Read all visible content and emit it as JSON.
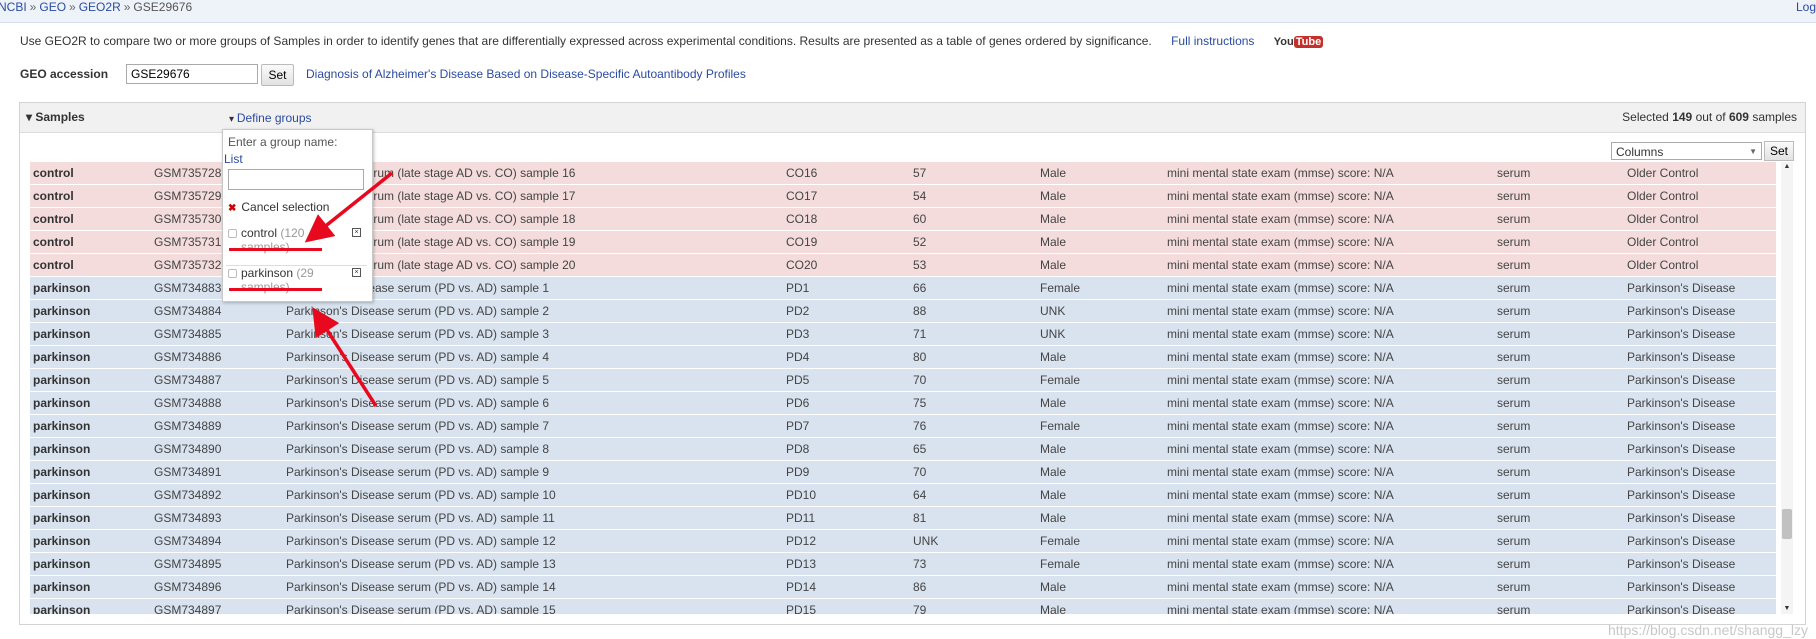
{
  "breadcrumb": {
    "items": [
      "NCBI",
      "GEO",
      "GEO2R",
      "GSE29676"
    ],
    "separator": "»",
    "login": "Log"
  },
  "intro": {
    "text": "Use GEO2R to compare two or more groups of Samples in order to identify genes that are differentially expressed across experimental conditions. Results are presented as a table of genes ordered by significance.",
    "link": "Full instructions",
    "youtube_you": "You",
    "youtube_tube": "Tube"
  },
  "accession": {
    "label": "GEO accession",
    "value": "GSE29676",
    "set_label": "Set",
    "study_title": "Diagnosis of Alzheimer's Disease Based on Disease-Specific Autoantibody Profiles"
  },
  "samples_panel": {
    "title": "Samples",
    "define_groups": "Define groups",
    "selected_prefix": "Selected",
    "selected_count": "149",
    "selected_mid": "out of",
    "total_count": "609",
    "selected_suffix": "samples",
    "columns_select": "Columns",
    "columns_set": "Set"
  },
  "group_popup": {
    "prompt": "Enter a group name:",
    "list_link": "List",
    "cancel": "Cancel selection",
    "groups": [
      {
        "name": "control",
        "count": "(120 samples)"
      },
      {
        "name": "parkinson",
        "count": "(29 samples)"
      }
    ]
  },
  "colors": {
    "control_row": "#f4dcdc",
    "parkinson_row": "#d8e3ef",
    "annotation_red": "#e8091e",
    "link_blue": "#2a4ba1"
  },
  "rows": [
    {
      "group": "control",
      "acc": "GSM735728",
      "title": "Older Control serum (late stage AD vs. CO) sample 16",
      "id": "CO16",
      "age": "57",
      "sex": "Male",
      "mmse": "mini mental state exam (mmse) score: N/A",
      "source": "serum",
      "disease": "Older Control"
    },
    {
      "group": "control",
      "acc": "GSM735729",
      "title": "Older Control serum (late stage AD vs. CO) sample 17",
      "id": "CO17",
      "age": "54",
      "sex": "Male",
      "mmse": "mini mental state exam (mmse) score: N/A",
      "source": "serum",
      "disease": "Older Control"
    },
    {
      "group": "control",
      "acc": "GSM735730",
      "title": "Older Control serum (late stage AD vs. CO) sample 18",
      "id": "CO18",
      "age": "60",
      "sex": "Male",
      "mmse": "mini mental state exam (mmse) score: N/A",
      "source": "serum",
      "disease": "Older Control"
    },
    {
      "group": "control",
      "acc": "GSM735731",
      "title": "Older Control serum (late stage AD vs. CO) sample 19",
      "id": "CO19",
      "age": "52",
      "sex": "Male",
      "mmse": "mini mental state exam (mmse) score: N/A",
      "source": "serum",
      "disease": "Older Control"
    },
    {
      "group": "control",
      "acc": "GSM735732",
      "title": "Older Control serum (late stage AD vs. CO) sample 20",
      "id": "CO20",
      "age": "53",
      "sex": "Male",
      "mmse": "mini mental state exam (mmse) score: N/A",
      "source": "serum",
      "disease": "Older Control"
    },
    {
      "group": "parkinson",
      "acc": "GSM734883",
      "title": "Parkinson's Disease serum (PD vs. AD) sample 1",
      "id": "PD1",
      "age": "66",
      "sex": "Female",
      "mmse": "mini mental state exam (mmse) score: N/A",
      "source": "serum",
      "disease": "Parkinson's Disease"
    },
    {
      "group": "parkinson",
      "acc": "GSM734884",
      "title": "Parkinson's Disease serum (PD vs. AD) sample 2",
      "id": "PD2",
      "age": "88",
      "sex": "UNK",
      "mmse": "mini mental state exam (mmse) score: N/A",
      "source": "serum",
      "disease": "Parkinson's Disease"
    },
    {
      "group": "parkinson",
      "acc": "GSM734885",
      "title": "Parkinson's Disease serum (PD vs. AD) sample 3",
      "id": "PD3",
      "age": "71",
      "sex": "UNK",
      "mmse": "mini mental state exam (mmse) score: N/A",
      "source": "serum",
      "disease": "Parkinson's Disease"
    },
    {
      "group": "parkinson",
      "acc": "GSM734886",
      "title": "Parkinson's Disease serum (PD vs. AD) sample 4",
      "id": "PD4",
      "age": "80",
      "sex": "Male",
      "mmse": "mini mental state exam (mmse) score: N/A",
      "source": "serum",
      "disease": "Parkinson's Disease"
    },
    {
      "group": "parkinson",
      "acc": "GSM734887",
      "title": "Parkinson's Disease serum (PD vs. AD) sample 5",
      "id": "PD5",
      "age": "70",
      "sex": "Female",
      "mmse": "mini mental state exam (mmse) score: N/A",
      "source": "serum",
      "disease": "Parkinson's Disease"
    },
    {
      "group": "parkinson",
      "acc": "GSM734888",
      "title": "Parkinson's Disease serum (PD vs. AD) sample 6",
      "id": "PD6",
      "age": "75",
      "sex": "Male",
      "mmse": "mini mental state exam (mmse) score: N/A",
      "source": "serum",
      "disease": "Parkinson's Disease"
    },
    {
      "group": "parkinson",
      "acc": "GSM734889",
      "title": "Parkinson's Disease serum (PD vs. AD) sample 7",
      "id": "PD7",
      "age": "76",
      "sex": "Female",
      "mmse": "mini mental state exam (mmse) score: N/A",
      "source": "serum",
      "disease": "Parkinson's Disease"
    },
    {
      "group": "parkinson",
      "acc": "GSM734890",
      "title": "Parkinson's Disease serum (PD vs. AD) sample 8",
      "id": "PD8",
      "age": "65",
      "sex": "Male",
      "mmse": "mini mental state exam (mmse) score: N/A",
      "source": "serum",
      "disease": "Parkinson's Disease"
    },
    {
      "group": "parkinson",
      "acc": "GSM734891",
      "title": "Parkinson's Disease serum (PD vs. AD) sample 9",
      "id": "PD9",
      "age": "70",
      "sex": "Male",
      "mmse": "mini mental state exam (mmse) score: N/A",
      "source": "serum",
      "disease": "Parkinson's Disease"
    },
    {
      "group": "parkinson",
      "acc": "GSM734892",
      "title": "Parkinson's Disease serum (PD vs. AD) sample 10",
      "id": "PD10",
      "age": "64",
      "sex": "Male",
      "mmse": "mini mental state exam (mmse) score: N/A",
      "source": "serum",
      "disease": "Parkinson's Disease"
    },
    {
      "group": "parkinson",
      "acc": "GSM734893",
      "title": "Parkinson's Disease serum (PD vs. AD) sample 11",
      "id": "PD11",
      "age": "81",
      "sex": "Male",
      "mmse": "mini mental state exam (mmse) score: N/A",
      "source": "serum",
      "disease": "Parkinson's Disease"
    },
    {
      "group": "parkinson",
      "acc": "GSM734894",
      "title": "Parkinson's Disease serum (PD vs. AD) sample 12",
      "id": "PD12",
      "age": "UNK",
      "sex": "Female",
      "mmse": "mini mental state exam (mmse) score: N/A",
      "source": "serum",
      "disease": "Parkinson's Disease"
    },
    {
      "group": "parkinson",
      "acc": "GSM734895",
      "title": "Parkinson's Disease serum (PD vs. AD) sample 13",
      "id": "PD13",
      "age": "73",
      "sex": "Female",
      "mmse": "mini mental state exam (mmse) score: N/A",
      "source": "serum",
      "disease": "Parkinson's Disease"
    },
    {
      "group": "parkinson",
      "acc": "GSM734896",
      "title": "Parkinson's Disease serum (PD vs. AD) sample 14",
      "id": "PD14",
      "age": "86",
      "sex": "Male",
      "mmse": "mini mental state exam (mmse) score: N/A",
      "source": "serum",
      "disease": "Parkinson's Disease"
    },
    {
      "group": "parkinson",
      "acc": "GSM734897",
      "title": "Parkinson's Disease serum (PD vs. AD) sample 15",
      "id": "PD15",
      "age": "79",
      "sex": "Male",
      "mmse": "mini mental state exam (mmse) score: N/A",
      "source": "serum",
      "disease": "Parkinson's Disease"
    }
  ],
  "watermark": "https://blog.csdn.net/shangg_lzy"
}
